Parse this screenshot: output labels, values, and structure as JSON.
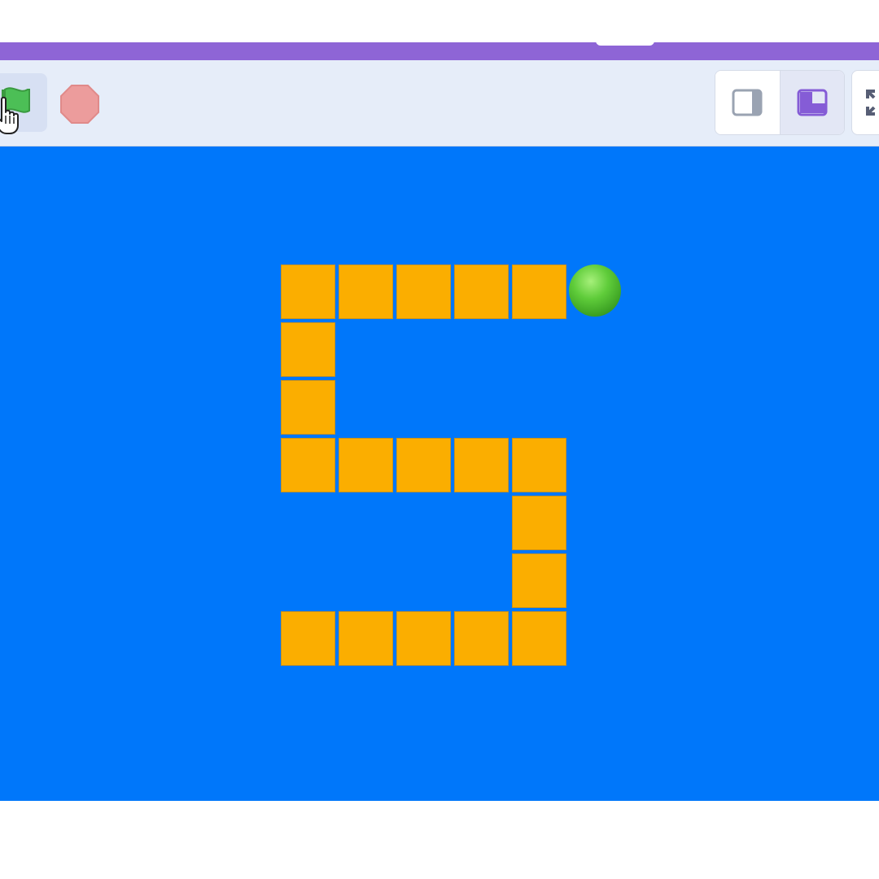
{
  "colors": {
    "menu_bar": "#8e65d6",
    "toolbar": "#e6edf9",
    "stage_background": "#0077fa",
    "tile": "#fbae00",
    "ball": "#5fcc3a",
    "green_flag": "#4cbf56",
    "stop_sign": "#ec9c9c",
    "selected_view": "#855cd6"
  },
  "toolbar": {
    "green_flag_icon": "green-flag-icon",
    "cursor_icon": "hand-pointer-icon",
    "stop_icon": "stop-sign-icon",
    "small_stage_icon": "small-stage-icon",
    "large_stage_icon": "large-stage-icon",
    "fullscreen_icon": "fullscreen-icon"
  },
  "stage": {
    "digit_shape": "5",
    "grid_columns": 5,
    "grid_rows": 7,
    "tiles": [
      {
        "col": 0,
        "row": 0
      },
      {
        "col": 1,
        "row": 0
      },
      {
        "col": 2,
        "row": 0
      },
      {
        "col": 3,
        "row": 0
      },
      {
        "col": 4,
        "row": 0
      },
      {
        "col": 0,
        "row": 1
      },
      {
        "col": 0,
        "row": 2
      },
      {
        "col": 0,
        "row": 3
      },
      {
        "col": 1,
        "row": 3
      },
      {
        "col": 2,
        "row": 3
      },
      {
        "col": 3,
        "row": 3
      },
      {
        "col": 4,
        "row": 3
      },
      {
        "col": 4,
        "row": 4
      },
      {
        "col": 4,
        "row": 5
      },
      {
        "col": 0,
        "row": 6
      },
      {
        "col": 1,
        "row": 6
      },
      {
        "col": 2,
        "row": 6
      },
      {
        "col": 3,
        "row": 6
      },
      {
        "col": 4,
        "row": 6
      }
    ],
    "ball": {
      "col": 5,
      "row": 0
    }
  }
}
